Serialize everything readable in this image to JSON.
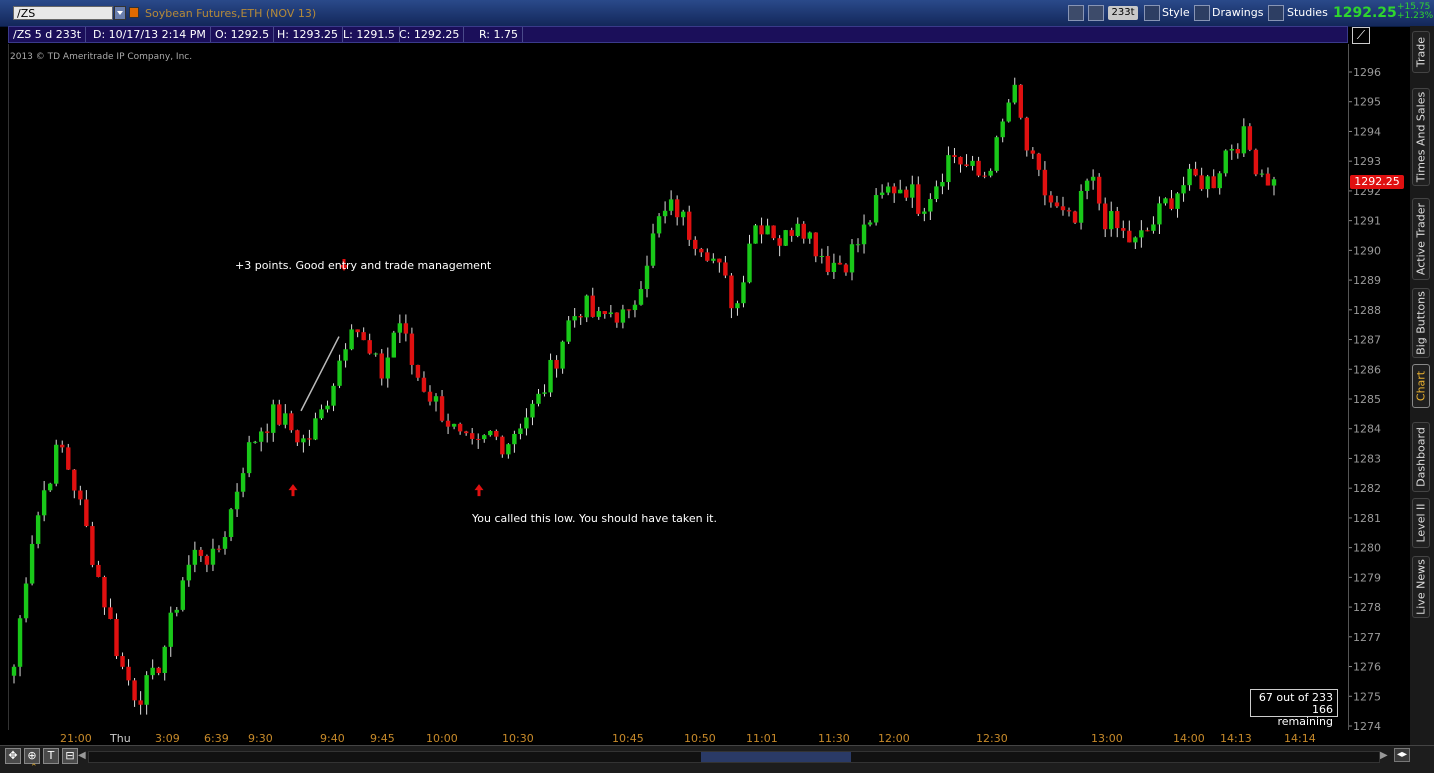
{
  "toolbar": {
    "symbol": "/ZS",
    "description": "Soybean Futures,ETH (NOV 13)",
    "aggregation_badge": "233t",
    "style_label": "Style",
    "drawings_label": "Drawings",
    "studies_label": "Studies",
    "last_price": "1292.25",
    "net_change": "+15.75",
    "pct_change": "+1.23%"
  },
  "infobar": {
    "symbol_period": "/ZS 5 d 233t",
    "date": "D: 10/17/13 2:14 PM",
    "open": "O: 1292.5",
    "high": "H: 1293.25",
    "low": "L: 1291.5",
    "close": "C: 1292.25",
    "range": "R: 1.75"
  },
  "copyright": "2013 © TD Ameritrade IP Company, Inc.",
  "annotations": {
    "note1": "+3 points.  Good entry and trade management",
    "note2": "You called this low.  You should have taken it."
  },
  "remaining_box": {
    "line1": "67  out of 233",
    "line2": "166 remaining"
  },
  "sidebar_tabs": [
    "Trade",
    "Times And Sales",
    "Active Trader",
    "Big Buttons",
    "Chart",
    "Dashboard",
    "Level II",
    "Live News"
  ],
  "colors": {
    "up": "#19c819",
    "down": "#e01010",
    "price_tag": "#e01010",
    "axis_text": "#9a9a9a",
    "time_text": "#c78a2a"
  },
  "chart_data": {
    "type": "candlestick",
    "y_axis": {
      "min": 1274,
      "max": 1296,
      "ticks": [
        1296,
        1295,
        1294,
        1293,
        1292,
        1291,
        1290,
        1289,
        1288,
        1287,
        1286,
        1285,
        1284,
        1283,
        1282,
        1281,
        1280,
        1279,
        1278,
        1277,
        1276,
        1275,
        1274
      ]
    },
    "x_labels": [
      "21:00",
      "Thu",
      "3:09",
      "6:39",
      "9:30",
      "9:40",
      "9:45",
      "10:00",
      "10:30",
      "10:45",
      "10:50",
      "11:01",
      "11:30",
      "12:00",
      "12:30",
      "13:00",
      "14:00",
      "14:13",
      "14:14"
    ],
    "current_price": "1292.25",
    "close_path": [
      1276,
      1280,
      1282,
      1283.5,
      1282,
      1280,
      1278,
      1276,
      1275,
      1275.5,
      1277,
      1279,
      1280,
      1279.5,
      1281,
      1283,
      1284,
      1284.5,
      1284,
      1283.5,
      1284.5,
      1286,
      1287.8,
      1286.5,
      1285.8,
      1287.8,
      1286,
      1285.2,
      1284.5,
      1283.6,
      1283.2,
      1283.8,
      1283.5,
      1284.3,
      1284.8,
      1286,
      1287.5,
      1288.2,
      1287.6,
      1288,
      1287.6,
      1289.5,
      1291,
      1291.5,
      1290.6,
      1290.2,
      1289.2,
      1288,
      1290.8,
      1291,
      1290.2,
      1291.2,
      1290.3,
      1289.6,
      1289.6,
      1290.3,
      1291.4,
      1292.1,
      1292.2,
      1291.5,
      1292.3,
      1293.3,
      1292.8,
      1292.4,
      1293.5,
      1295.5,
      1293.2,
      1292,
      1291.2,
      1290.8,
      1292.5,
      1291.1,
      1290.6,
      1290.2,
      1290.8,
      1291.6,
      1292.2,
      1292.4,
      1292.3,
      1293.5,
      1293.8,
      1292.8,
      1292.25
    ],
    "arrows": [
      {
        "dir": "down",
        "price": 1288.5,
        "bar": 18
      },
      {
        "dir": "up",
        "price": 1282,
        "bar": 14
      },
      {
        "dir": "up",
        "price": 1282,
        "bar": 24
      }
    ]
  }
}
